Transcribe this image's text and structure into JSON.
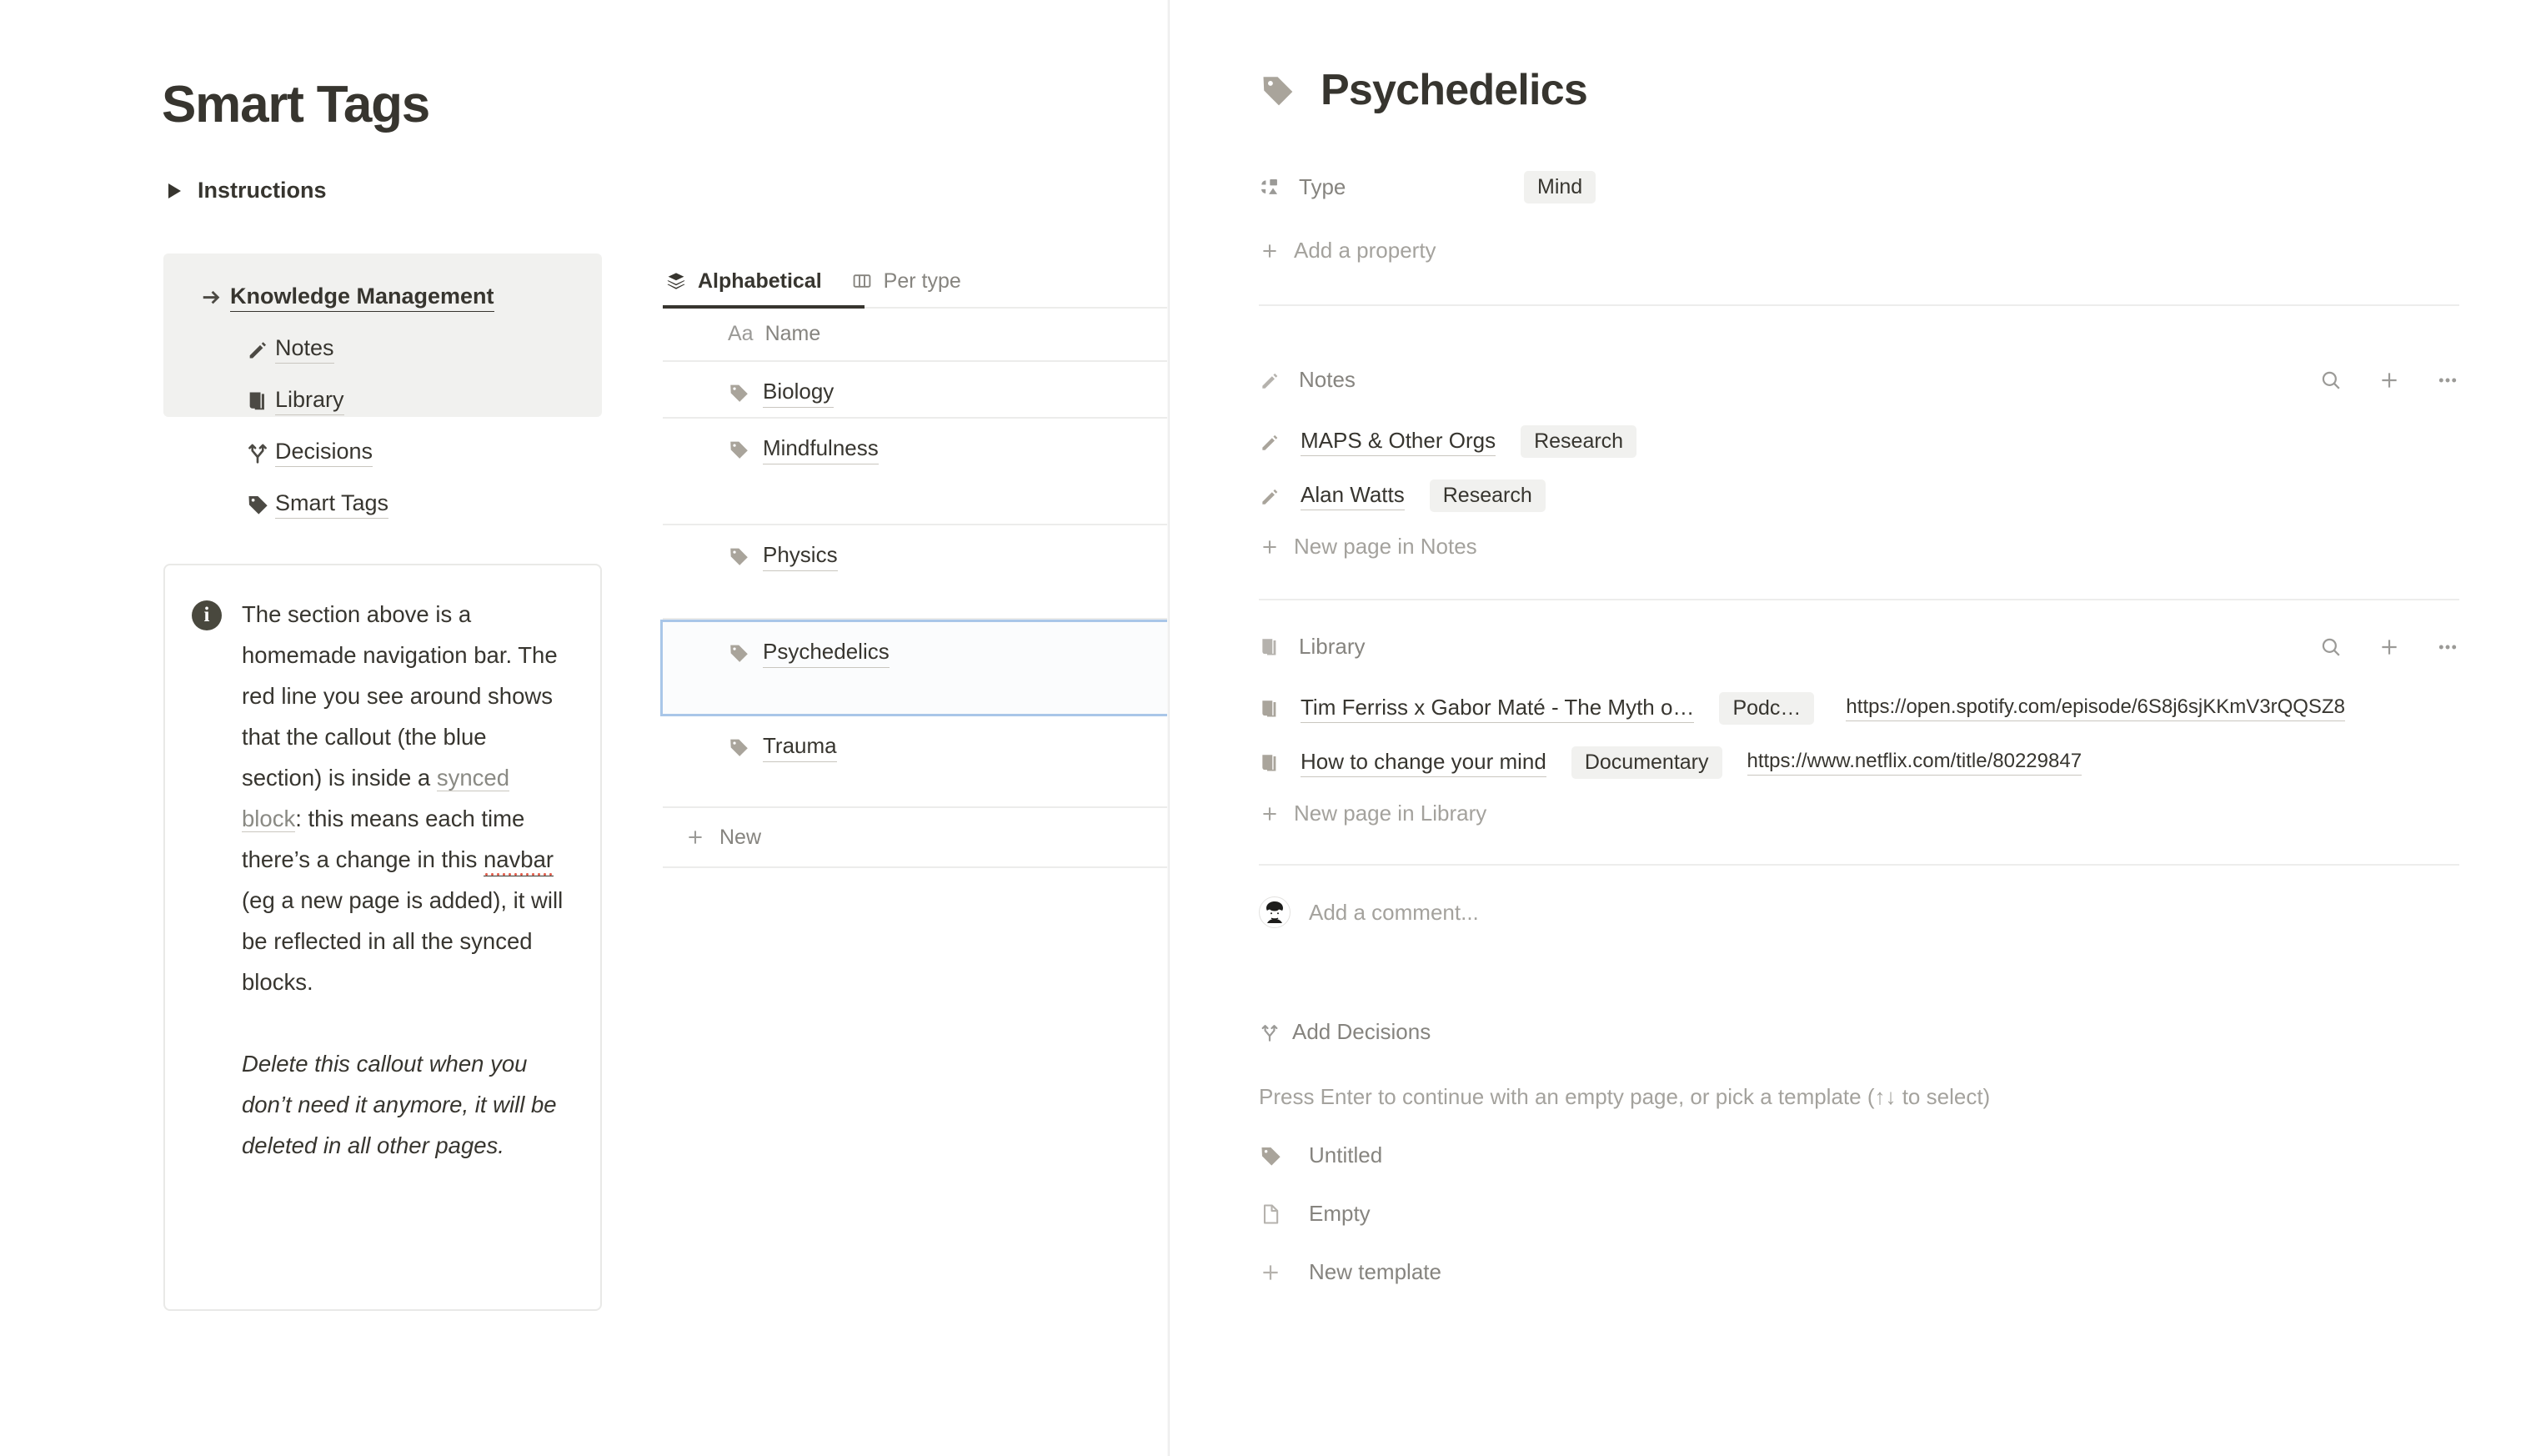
{
  "left": {
    "page_title": "Smart Tags",
    "instructions_label": "Instructions",
    "nav": {
      "items": [
        {
          "label": "Knowledge Management",
          "icon": "arrow-right-icon",
          "level": 0
        },
        {
          "label": "Notes",
          "icon": "pencil-icon",
          "level": 1
        },
        {
          "label": "Library",
          "icon": "book-icon",
          "level": 1
        },
        {
          "label": "Decisions",
          "icon": "branch-icon",
          "level": 1
        },
        {
          "label": "Smart Tags",
          "icon": "tag-icon",
          "level": 1
        }
      ]
    },
    "callout": {
      "icon": "info-icon",
      "para1_a": "The section above is a homemade navigation bar. The red line you see around shows that the callout (the blue section) is inside a ",
      "para1_link": "synced block",
      "para1_b": ": this means each time there’s a change in this ",
      "para1_word": "navbar",
      "para1_c": " (eg a new page is added), it will be reflected in all the synced blocks.",
      "para2": "Delete this callout when you don’t need it anymore, it will be deleted in all other pages."
    }
  },
  "middle": {
    "tabs": [
      {
        "label": "Alphabetical",
        "icon": "layers-icon",
        "active": true
      },
      {
        "label": "Per type",
        "icon": "columns-icon",
        "active": false
      }
    ],
    "column_header": {
      "type_glyph": "Aa",
      "name": "Name"
    },
    "rows": [
      {
        "name": "Biology",
        "icon": "tag-icon",
        "selected": false,
        "height": 68
      },
      {
        "name": "Mindfulness",
        "icon": "tag-icon",
        "selected": false,
        "height": 128
      },
      {
        "name": "Physics",
        "icon": "tag-icon",
        "selected": false,
        "height": 113
      },
      {
        "name": "Psychedelics",
        "icon": "tag-icon",
        "selected": true,
        "height": 116
      },
      {
        "name": "Trauma",
        "icon": "tag-icon",
        "selected": false,
        "height": 110
      }
    ],
    "new_row_label": "New"
  },
  "right": {
    "title": "Psychedelics",
    "title_icon": "tag-icon",
    "properties": [
      {
        "name": "Type",
        "icon": "shapes-icon",
        "value": "Mind"
      }
    ],
    "add_property_label": "Add a property",
    "sections": [
      {
        "key": "notes",
        "label": "Notes",
        "icon": "pencil-icon",
        "actions": [
          "search-icon",
          "plus-icon",
          "ellipsis-icon"
        ],
        "items": [
          {
            "title": "MAPS & Other Orgs",
            "icon": "pencil-icon",
            "pill": "Research",
            "url": ""
          },
          {
            "title": "Alan Watts",
            "icon": "pencil-icon",
            "pill": "Research",
            "url": ""
          }
        ],
        "new_label": "New page in Notes"
      },
      {
        "key": "library",
        "label": "Library",
        "icon": "book-icon",
        "actions": [
          "search-icon",
          "plus-icon",
          "ellipsis-icon"
        ],
        "items": [
          {
            "title": "Tim Ferriss x Gabor Maté - The Myth o…",
            "icon": "book-icon",
            "pill": "Podc…",
            "url": "https://open.spotify.com/episode/6S8j6sjKKmV3rQQSZ8"
          },
          {
            "title": "How to change your mind",
            "icon": "book-icon",
            "pill": "Documentary",
            "url": "https://www.netflix.com/title/80229847"
          }
        ],
        "new_label": "New page in Library"
      }
    ],
    "comment_placeholder": "Add a comment...",
    "add_decisions_label": "Add Decisions",
    "add_decisions_icon": "branch-icon",
    "template_hint": "Press Enter to continue with an empty page, or pick a template (↑↓ to select)",
    "templates": [
      {
        "label": "Untitled",
        "icon": "tag-icon"
      },
      {
        "label": "Empty",
        "icon": "page-icon"
      },
      {
        "label": "New template",
        "icon": "plus-icon"
      }
    ]
  },
  "colors": {
    "text": "#37352f",
    "muted": "#86847f",
    "placeholder": "#a4a29d",
    "tag_grey": "#a9a49b",
    "card_bg": "#f1f1ef",
    "selection_blue": "#a9c6e8",
    "red_underline": "#e25c4a"
  }
}
